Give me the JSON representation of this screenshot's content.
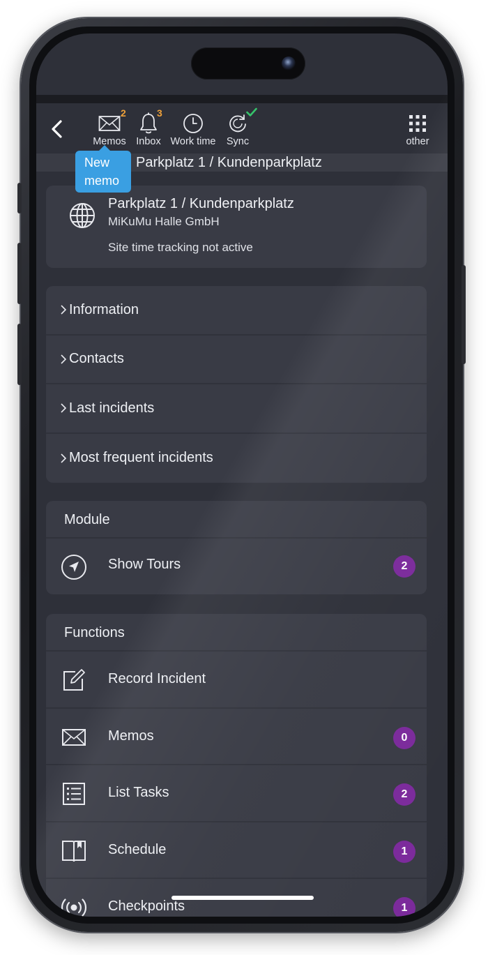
{
  "toolbar": {
    "items": [
      {
        "label": "Memos",
        "count": "2",
        "icon": "envelope-icon"
      },
      {
        "label": "Inbox",
        "count": "3",
        "icon": "bell-icon"
      },
      {
        "label": "Work time",
        "icon": "clock-icon"
      },
      {
        "label": "Sync",
        "icon": "sync-icon",
        "status": "synced"
      }
    ],
    "other_label": "other"
  },
  "tooltip": {
    "text": "New memo"
  },
  "title": "Parkplatz 1 / Kundenparkplatz",
  "site": {
    "name": "Parkplatz 1 / Kundenparkplatz",
    "company": "MiKuMu Halle GmbH",
    "status": "Site time tracking not active"
  },
  "accordion": [
    {
      "label": "Information"
    },
    {
      "label": "Contacts"
    },
    {
      "label": "Last incidents"
    },
    {
      "label": "Most frequent incidents"
    }
  ],
  "module": {
    "heading": "Module",
    "items": [
      {
        "label": "Show Tours",
        "badge": "2",
        "icon": "navigation-icon"
      }
    ]
  },
  "functions": {
    "heading": "Functions",
    "items": [
      {
        "label": "Record Incident",
        "icon": "edit-icon"
      },
      {
        "label": "Memos",
        "badge": "0",
        "icon": "envelope-icon"
      },
      {
        "label": "List Tasks",
        "badge": "2",
        "icon": "list-icon"
      },
      {
        "label": "Schedule",
        "badge": "1",
        "icon": "book-icon"
      },
      {
        "label": "Checkpoints",
        "badge": "1",
        "icon": "broadcast-icon"
      }
    ]
  },
  "colors": {
    "background": "#2e3039",
    "card": "#393b45",
    "tooltip": "#3a9fe2",
    "badge": "#7b2a9b",
    "count": "#f0a23a",
    "check": "#36c46b"
  }
}
